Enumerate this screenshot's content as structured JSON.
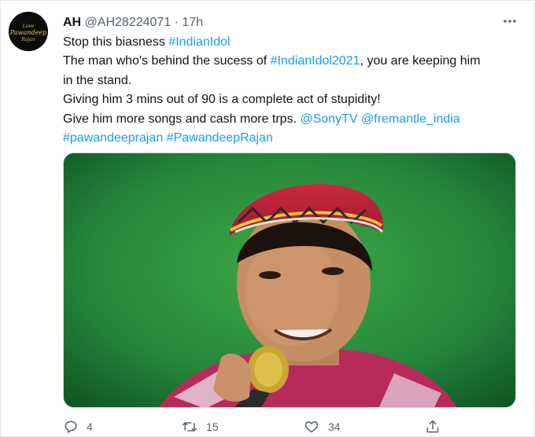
{
  "tweet": {
    "author_name": "AH",
    "handle": "@AH28224071",
    "separator": "·",
    "time": "17h",
    "text_segments": [
      [
        {
          "t": "Stop this biasness ",
          "link": false
        },
        {
          "t": "#IndianIdol",
          "link": true
        }
      ],
      [
        {
          "t": "The man who's behind the sucess of ",
          "link": false
        },
        {
          "t": "#IndianIdol2021",
          "link": true
        },
        {
          "t": ", you are keeping him",
          "link": false
        }
      ],
      [
        {
          "t": "in the stand.",
          "link": false
        }
      ],
      [
        {
          "t": "Giving him 3 mins out of 90 is a complete act of stupidity!",
          "link": false
        }
      ],
      [
        {
          "t": "Give him more songs and cash more trps. ",
          "link": false
        },
        {
          "t": "@SonyTV",
          "link": true
        },
        {
          "t": " ",
          "link": false
        },
        {
          "t": "@fremantle_india",
          "link": true
        }
      ],
      [
        {
          "t": "#pawandeeprajan",
          "link": true
        },
        {
          "t": " ",
          "link": false
        },
        {
          "t": "#PawandeepRajan",
          "link": true
        }
      ]
    ],
    "actions": {
      "reply_count": "4",
      "retweet_count": "15",
      "like_count": "34"
    }
  },
  "colors": {
    "link": "#1d9bf0",
    "secondary_text": "#536471",
    "primary_text": "#0f1419"
  },
  "icons": [
    "more-icon",
    "reply-icon",
    "retweet-icon",
    "like-icon",
    "share-icon"
  ]
}
